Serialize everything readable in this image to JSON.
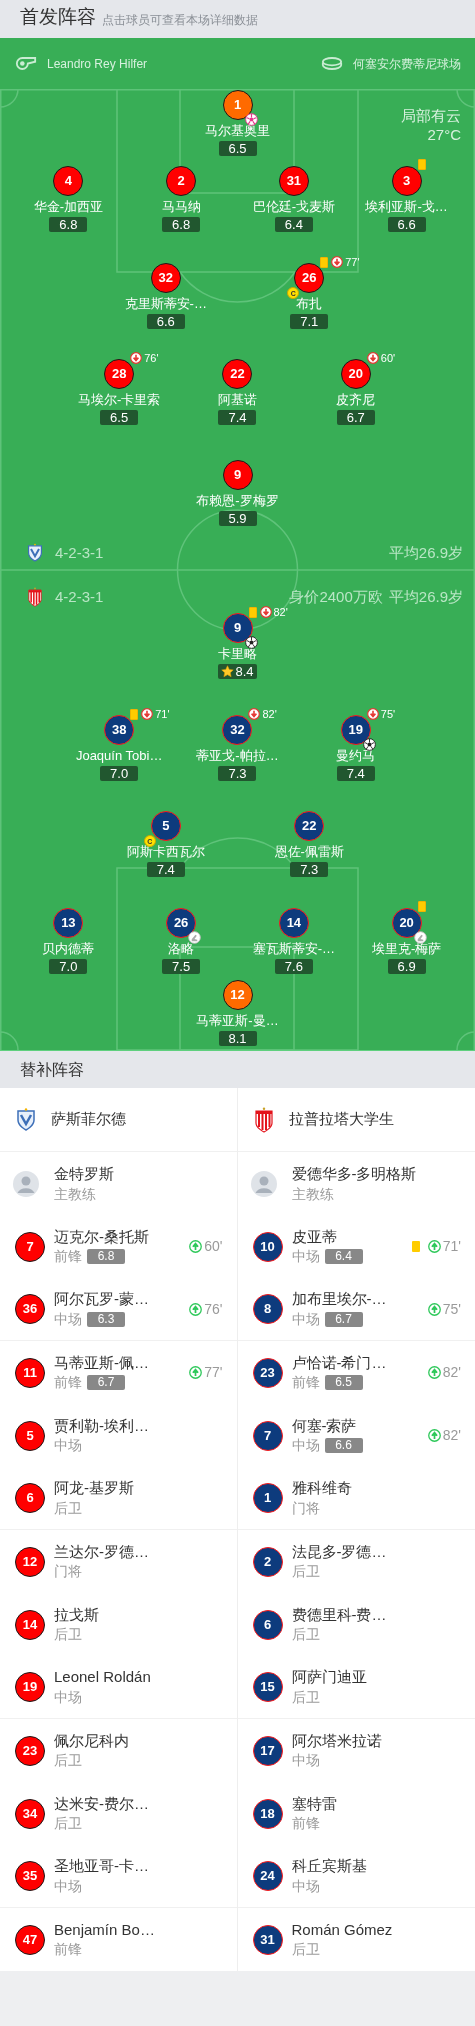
{
  "header": {
    "title": "首发阵容",
    "hint": "点击球员可查看本场详细数据"
  },
  "match_info": {
    "referee": "Leandro Rey Hilfer",
    "venue": "何塞安尔费蒂尼球场",
    "weather": "局部有云",
    "temperature": "27°C"
  },
  "lineups": [
    {
      "kind": "home",
      "formation": "4-2-3-1",
      "average_age": "平均26.9岁",
      "rows": [
        [
          {
            "number": "1",
            "name": "马尔基奥里",
            "rating": "6.5",
            "kind": "goalkeeper",
            "best": false,
            "events": [
              {
                "kind": "own_goal"
              }
            ]
          }
        ],
        [
          {
            "number": "4",
            "name": "华金-加西亚",
            "rating": "6.8",
            "kind": "outfield",
            "best": false
          },
          {
            "number": "2",
            "name": "马马纳",
            "rating": "6.8",
            "kind": "outfield",
            "best": false
          },
          {
            "number": "31",
            "name": "巴伦廷-戈麦斯",
            "rating": "6.4",
            "kind": "outfield",
            "best": false
          },
          {
            "number": "3",
            "name": "埃利亚斯-戈…",
            "rating": "6.6",
            "kind": "outfield",
            "best": false,
            "events": [
              {
                "kind": "yellow_card"
              }
            ]
          }
        ],
        [
          {
            "number": "32",
            "name": "克里斯蒂安-…",
            "rating": "6.6",
            "kind": "outfield",
            "best": false
          },
          {
            "number": "26",
            "name": "布扎",
            "rating": "7.1",
            "kind": "outfield",
            "best": false,
            "events": [
              {
                "kind": "yellow_card"
              },
              {
                "kind": "sub_out",
                "minute": "77'"
              },
              {
                "kind": "captain",
                "label": "C"
              }
            ]
          }
        ],
        [
          {
            "number": "28",
            "name": "马埃尔-卡里索",
            "rating": "6.5",
            "kind": "outfield",
            "best": false,
            "events": [
              {
                "kind": "sub_out",
                "minute": "76'"
              }
            ]
          },
          {
            "number": "22",
            "name": "阿基诺",
            "rating": "7.4",
            "kind": "outfield",
            "best": false
          },
          {
            "number": "20",
            "name": "皮齐尼",
            "rating": "6.7",
            "kind": "outfield",
            "best": false,
            "events": [
              {
                "kind": "sub_out",
                "minute": "60'"
              }
            ]
          }
        ],
        [
          {
            "number": "9",
            "name": "布赖恩-罗梅罗",
            "rating": "5.9",
            "kind": "outfield",
            "best": false
          }
        ]
      ]
    },
    {
      "kind": "away",
      "formation": "4-2-3-1",
      "market_value": "身价2400万欧",
      "average_age": "平均26.9岁",
      "rows": [
        [
          {
            "number": "9",
            "name": "卡里略",
            "rating": "8.4",
            "kind": "outfield",
            "best": true,
            "events": [
              {
                "kind": "yellow_card"
              },
              {
                "kind": "sub_out",
                "minute": "82'"
              },
              {
                "kind": "goal"
              }
            ]
          }
        ],
        [
          {
            "number": "38",
            "name": "Joaquín Tobi…",
            "rating": "7.0",
            "kind": "outfield",
            "best": false,
            "events": [
              {
                "kind": "yellow_card"
              },
              {
                "kind": "sub_out",
                "minute": "71'"
              }
            ]
          },
          {
            "number": "32",
            "name": "蒂亚戈-帕拉…",
            "rating": "7.3",
            "kind": "outfield",
            "best": false,
            "events": [
              {
                "kind": "sub_out",
                "minute": "82'"
              }
            ]
          },
          {
            "number": "19",
            "name": "曼约马",
            "rating": "7.4",
            "kind": "outfield",
            "best": false,
            "events": [
              {
                "kind": "sub_out",
                "minute": "75'"
              },
              {
                "kind": "goal"
              }
            ]
          }
        ],
        [
          {
            "number": "5",
            "name": "阿斯卡西瓦尔",
            "rating": "7.4",
            "kind": "outfield",
            "best": false,
            "events": [
              {
                "kind": "captain",
                "label": "C"
              }
            ]
          },
          {
            "number": "22",
            "name": "恩佐-佩雷斯",
            "rating": "7.3",
            "kind": "outfield",
            "best": false
          }
        ],
        [
          {
            "number": "13",
            "name": "贝内德蒂",
            "rating": "7.0",
            "kind": "outfield",
            "best": false
          },
          {
            "number": "26",
            "name": "洛略",
            "rating": "7.5",
            "kind": "outfield",
            "best": false,
            "events": [
              {
                "kind": "assist"
              }
            ]
          },
          {
            "number": "14",
            "name": "塞瓦斯蒂安-…",
            "rating": "7.6",
            "kind": "outfield",
            "best": false
          },
          {
            "number": "20",
            "name": "埃里克-梅萨",
            "rating": "6.9",
            "kind": "outfield",
            "best": false,
            "events": [
              {
                "kind": "yellow_card"
              },
              {
                "kind": "assist"
              }
            ]
          }
        ],
        [
          {
            "number": "12",
            "name": "马蒂亚斯-曼…",
            "rating": "8.1",
            "kind": "goalkeeper",
            "best": false
          }
        ]
      ]
    }
  ],
  "substitutes_title": "替补阵容",
  "teams": [
    {
      "kind": "home",
      "name": "萨斯菲尔德",
      "coach": {
        "name": "金特罗斯",
        "role": "主教练"
      },
      "substitutes": [
        {
          "number": "7",
          "name": "迈克尔-桑托斯",
          "position": "前锋",
          "rating": "6.8",
          "events": [
            {
              "kind": "sub_in",
              "minute": "60'"
            }
          ]
        },
        {
          "number": "36",
          "name": "阿尔瓦罗-蒙…",
          "position": "中场",
          "rating": "6.3",
          "events": [
            {
              "kind": "sub_in",
              "minute": "76'"
            }
          ]
        },
        {
          "number": "11",
          "name": "马蒂亚斯-佩…",
          "position": "前锋",
          "rating": "6.7",
          "events": [
            {
              "kind": "sub_in",
              "minute": "77'"
            }
          ]
        },
        {
          "number": "5",
          "name": "贾利勒-埃利…",
          "position": "中场"
        },
        {
          "number": "6",
          "name": "阿龙-基罗斯",
          "position": "后卫"
        },
        {
          "number": "12",
          "name": "兰达尔-罗德…",
          "position": "门将"
        },
        {
          "number": "14",
          "name": "拉戈斯",
          "position": "后卫"
        },
        {
          "number": "19",
          "name": "Leonel Roldán",
          "position": "中场"
        },
        {
          "number": "23",
          "name": "佩尔尼科内",
          "position": "后卫"
        },
        {
          "number": "34",
          "name": "达米安-费尔…",
          "position": "后卫"
        },
        {
          "number": "35",
          "name": "圣地亚哥-卡…",
          "position": "中场"
        },
        {
          "number": "47",
          "name": "Benjamín Bo…",
          "position": "前锋"
        }
      ]
    },
    {
      "kind": "away",
      "name": "拉普拉塔大学生",
      "coach": {
        "name": "爱德华多-多明格斯",
        "role": "主教练"
      },
      "substitutes": [
        {
          "number": "10",
          "name": "皮亚蒂",
          "position": "中场",
          "rating": "6.4",
          "events": [
            {
              "kind": "yellow_card"
            },
            {
              "kind": "sub_in",
              "minute": "71'"
            }
          ]
        },
        {
          "number": "8",
          "name": "加布里埃尔-…",
          "position": "中场",
          "rating": "6.7",
          "events": [
            {
              "kind": "sub_in",
              "minute": "75'"
            }
          ]
        },
        {
          "number": "23",
          "name": "卢恰诺-希门…",
          "position": "前锋",
          "rating": "6.5",
          "events": [
            {
              "kind": "sub_in",
              "minute": "82'"
            }
          ]
        },
        {
          "number": "7",
          "name": "何塞-索萨",
          "position": "中场",
          "rating": "6.6",
          "events": [
            {
              "kind": "sub_in",
              "minute": "82'"
            }
          ]
        },
        {
          "number": "1",
          "name": "雅科维奇",
          "position": "门将"
        },
        {
          "number": "2",
          "name": "法昆多-罗德…",
          "position": "后卫"
        },
        {
          "number": "6",
          "name": "费德里科-费…",
          "position": "后卫"
        },
        {
          "number": "15",
          "name": "阿萨门迪亚",
          "position": "后卫"
        },
        {
          "number": "17",
          "name": "阿尔塔米拉诺",
          "position": "中场"
        },
        {
          "number": "18",
          "name": "塞特雷",
          "position": "前锋"
        },
        {
          "number": "24",
          "name": "科丘宾斯基",
          "position": "中场"
        },
        {
          "number": "31",
          "name": "Román Gómez",
          "position": "后卫"
        }
      ]
    }
  ]
}
